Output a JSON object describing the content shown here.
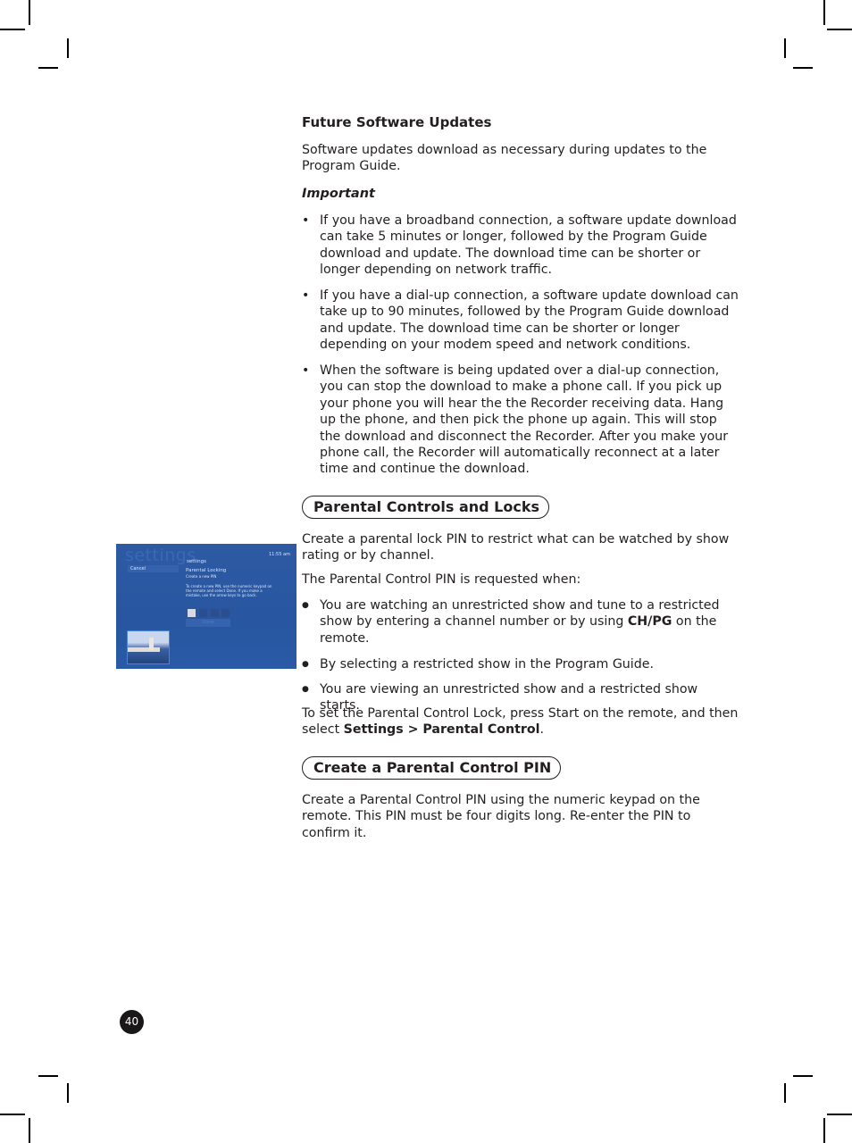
{
  "section1": {
    "title": "Future Software Updates",
    "intro": "Software updates download as necessary during updates to the Program Guide.",
    "important_label": "Important",
    "bullets": [
      "If you have a broadband connection, a software update download can take 5 minutes or longer, followed by the Program Guide download and update. The download time can be shorter or longer depending on network traffic.",
      "If you have a dial-up connection, a software update download can take up to 90 minutes, followed by the Program Guide download and update. The download time can be shorter or longer depending on your modem speed and network conditions.",
      "When the software is being updated over a dial-up connection, you can stop the download to make a phone call. If you pick up your phone you will hear the the Recorder receiving data. Hang up the phone, and then pick the phone up again. This will stop the download and disconnect the Recorder. After you make your phone call, the Recorder will automatically reconnect at a later time and continue the download."
    ],
    "bullet_glyph": "•"
  },
  "section2": {
    "title": "Parental Controls and Locks",
    "intro": "Create a parental lock PIN to restrict what can be watched by show rating or by channel.",
    "requested_when": "The Parental Control PIN is requested when:",
    "bullets": [
      {
        "before": "You are watching an unrestricted show and tune to a restricted show by entering a channel number or by using ",
        "bold": "CH/PG",
        "after": " on the remote."
      },
      {
        "before": "By selecting a restricted show in the Program Guide.",
        "bold": "",
        "after": ""
      },
      {
        "before": "You are viewing an unrestricted show and a restricted show starts.",
        "bold": "",
        "after": ""
      }
    ],
    "bullet_glyph": "●",
    "instruction_before": "To set the Parental Control Lock, press Start on the remote, and then select ",
    "instruction_bold": "Settings > Parental Control",
    "instruction_after": "."
  },
  "section3": {
    "title": "Create a Parental Control PIN",
    "body": "Create a Parental Control PIN using the numeric keypad on the remote. This PIN must be four digits long. Re-enter the PIN to confirm it."
  },
  "tv_screen": {
    "background_word": "settings",
    "header": "settings",
    "time": "11:55 am",
    "cancel_label": "Cancel",
    "title": "Parental Locking",
    "subtitle": "Create a new PIN",
    "instructions_lines": [
      "To create a new PIN, use the numeric keypad on",
      "the remote and select Done. If you make a",
      "mistake, use the arrow keys to go back."
    ],
    "pin_digits_entered": 1,
    "pin_length": 4,
    "done_label": "Done"
  },
  "page_number": "40"
}
